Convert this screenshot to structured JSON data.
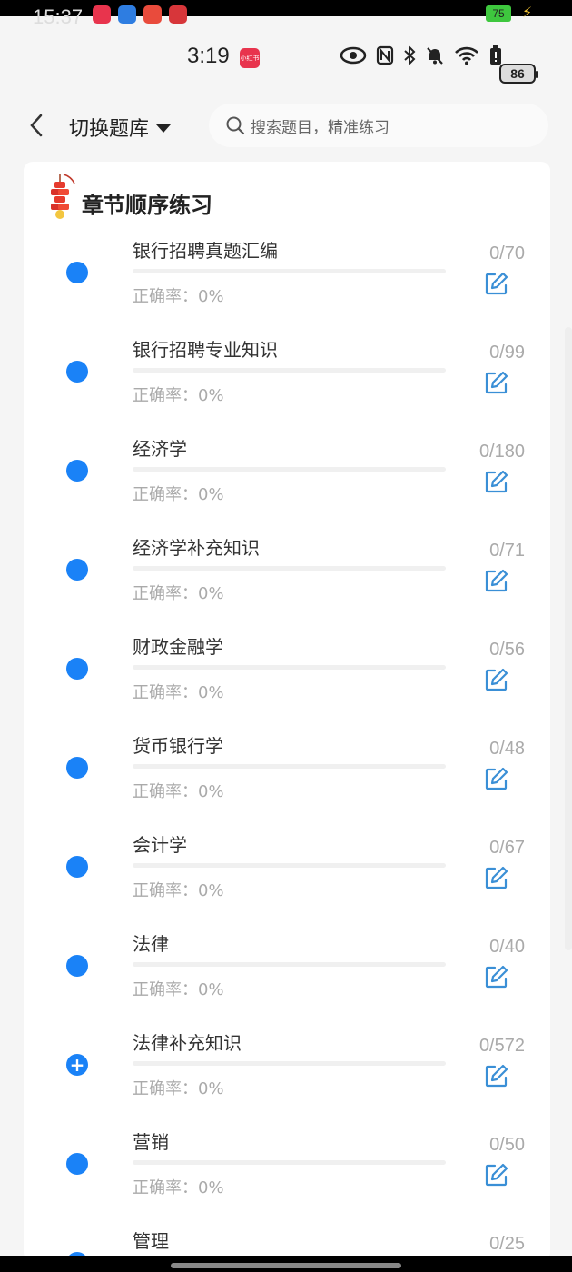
{
  "status": {
    "ghost_time": "15:37",
    "time": "3:19",
    "app_badge": "小红书",
    "battery_small": "75",
    "battery": "86"
  },
  "header": {
    "switch_label": "切换题库",
    "search_placeholder": "搜索题目，精准练习"
  },
  "section": {
    "title": "章节顺序练习"
  },
  "accuracy_label": "正确率：0%",
  "items": [
    {
      "title": "银行招聘真题汇编",
      "count": "0/70",
      "expanded": false
    },
    {
      "title": "银行招聘专业知识",
      "count": "0/99",
      "expanded": false
    },
    {
      "title": "经济学",
      "count": "0/180",
      "expanded": false
    },
    {
      "title": "经济学补充知识",
      "count": "0/71",
      "expanded": false
    },
    {
      "title": "财政金融学",
      "count": "0/56",
      "expanded": false
    },
    {
      "title": "货币银行学",
      "count": "0/48",
      "expanded": false
    },
    {
      "title": "会计学",
      "count": "0/67",
      "expanded": false
    },
    {
      "title": "法律",
      "count": "0/40",
      "expanded": false
    },
    {
      "title": "法律补充知识",
      "count": "0/572",
      "expanded": true
    },
    {
      "title": "营销",
      "count": "0/50",
      "expanded": false
    },
    {
      "title": "管理",
      "count": "0/25",
      "expanded": false
    }
  ],
  "colors": {
    "accent": "#1a82f7",
    "edit_icon": "#3a8fd6"
  }
}
